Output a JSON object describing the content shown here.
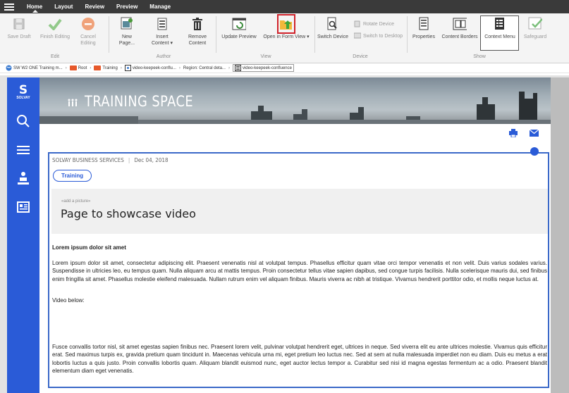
{
  "menubar": {
    "items": [
      {
        "label": "Home"
      },
      {
        "label": "Layout"
      },
      {
        "label": "Review"
      },
      {
        "label": "Preview"
      },
      {
        "label": "Manage"
      }
    ]
  },
  "ribbon": {
    "edit": {
      "save_draft": "Save Draft",
      "finish_editing": "Finish Editing",
      "cancel_editing": "Cancel\nEditing",
      "group_label": "Edit"
    },
    "author": {
      "new_page": "New\nPage...",
      "insert_content": "Insert\nContent ▾",
      "remove_content": "Remove\nContent",
      "group_label": "Author"
    },
    "view": {
      "update_preview": "Update Preview",
      "open_in_form_view": "Open in Form View ▾",
      "group_label": "View"
    },
    "device": {
      "switch_device": "Switch Device",
      "rotate_device": "Rotate Device",
      "switch_to_desktop": "Switch to Desktop",
      "group_label": "Device"
    },
    "show": {
      "properties": "Properties",
      "content_borders": "Content Borders",
      "context_menu": "Context Menu",
      "safeguard": "Safeguard",
      "group_label": "Show"
    }
  },
  "breadcrumb": [
    {
      "label": "SW W2 ONE Training m...",
      "icon": "globe-icon"
    },
    {
      "label": "Root",
      "icon": "folder-icon"
    },
    {
      "label": "Training",
      "icon": "folder-icon"
    },
    {
      "label": "video-keepeek-conflu...",
      "icon": "page-icon"
    },
    {
      "label": "Region: Central deta...",
      "icon": "none"
    },
    {
      "label": "video-keepeek-confluence",
      "icon": "content-icon"
    }
  ],
  "brand": {
    "label": "SOLVAY",
    "accent": "#2a5bd7"
  },
  "banner": {
    "title": "TRAINING SPACE"
  },
  "article": {
    "source": "SOLVAY BUSINESS SERVICES",
    "date": "Dec 04, 2018",
    "tag": "Training",
    "add_picture": "«add a picture»",
    "title": "Page to showcase video",
    "heading": "Lorem ipsum dolor sit amet",
    "para1": "Lorem ipsum dolor sit amet, consectetur adipiscing elit. Praesent venenatis nisl at volutpat tempus. Phasellus efficitur quam vitae orci tempor venenatis et non velit. Duis varius sodales varius. Suspendisse in ultricies leo, eu tempus quam. Nulla aliquam arcu at mattis tempus. Proin consectetur tellus vitae sapien dapibus, sed congue turpis facilisis. Nulla scelerisque mauris dui, sed finibus enim fringilla sit amet. Phasellus molestie eleifend malesuada. Nullam rutrum enim vel aliquam finibus. Mauris viverra ac nibh at tristique. Vivamus hendrerit porttitor odio, et mollis neque luctus at.",
    "video_label": "Video below:",
    "para2": "Fusce convallis tortor nisl, sit amet egestas sapien finibus nec. Praesent lorem velit, pulvinar volutpat hendrerit eget, ultrices in neque. Sed viverra elit eu ante ultrices molestie. Vivamus quis efficitur erat. Sed maximus turpis ex, gravida pretium quam tincidunt in. Maecenas vehicula urna mi, eget pretium leo luctus nec. Sed at sem at nulla malesuada imperdiet non eu diam. Duis eu metus a erat lobortis luctus a quis justo. Proin convallis lobortis quam. Aliquam blandit euismod nunc, eget auctor lectus tempor a. Curabitur sed nisi id magna egestas fermentum ac a odio. Praesent blandit elementum diam eget venenatis."
  },
  "colors": {
    "highlight": "#d0222a",
    "brand_blue": "#2a5bd7",
    "menubar": "#3a3a3a"
  }
}
